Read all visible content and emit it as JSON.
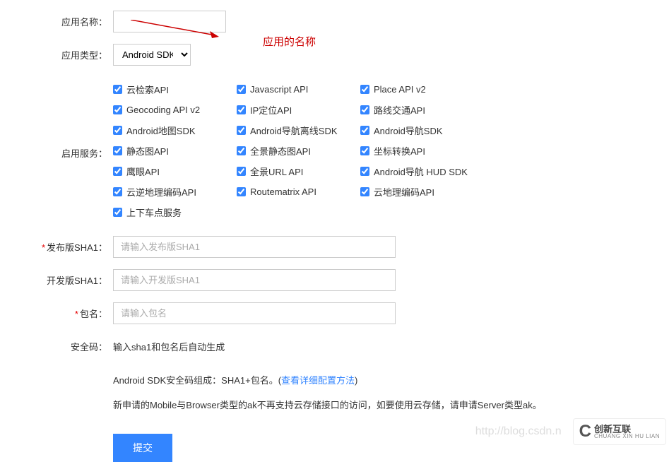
{
  "labels": {
    "app_name": "应用名称：",
    "app_type": "应用类型：",
    "services": "启用服务：",
    "release_sha1": "发布版SHA1：",
    "dev_sha1": "开发版SHA1：",
    "package_name": "包名：",
    "security_code": "安全码：",
    "required_mark": "*"
  },
  "app_type_value": "Android SDK",
  "services": [
    "云检索API",
    "Javascript API",
    "Place API v2",
    "Geocoding API v2",
    "IP定位API",
    "路线交通API",
    "Android地图SDK",
    "Android导航离线SDK",
    "Android导航SDK",
    "静态图API",
    "全景静态图API",
    "坐标转换API",
    "鹰眼API",
    "全景URL API",
    "Android导航 HUD SDK",
    "云逆地理编码API",
    "Routematrix API",
    "云地理编码API",
    "上下车点服务"
  ],
  "placeholders": {
    "release_sha1": "请输入发布版SHA1",
    "dev_sha1": "请输入开发版SHA1",
    "package_name": "请输入包名"
  },
  "security_hint": "输入sha1和包名后自动生成",
  "sdk_info_prefix": "Android SDK安全码组成：SHA1+包名。(",
  "sdk_info_link": "查看详细配置方法",
  "sdk_info_suffix": ")",
  "ak_notice": "新申请的Mobile与Browser类型的ak不再支持云存储接口的访问，如要使用云存储，请申请Server类型ak。",
  "submit_label": "提交",
  "annotation": "应用的名称",
  "watermark": {
    "url": "http://blog.csdn.n",
    "logo_cn": "创新互联",
    "logo_en": "CHUANG XIN HU LIAN"
  }
}
